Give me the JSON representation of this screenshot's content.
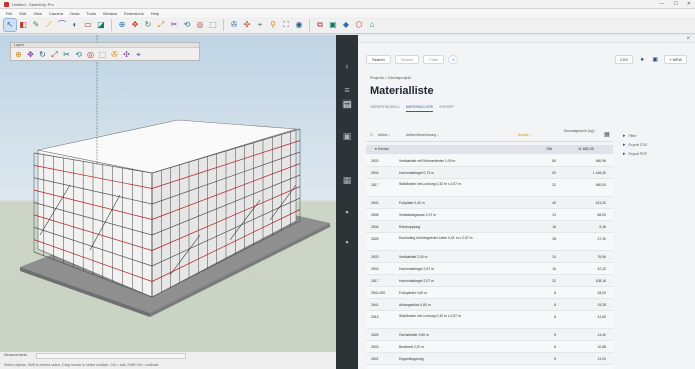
{
  "window": {
    "title": "Untitled - SketchUp Pro",
    "controls": [
      "—",
      "☐",
      "✕"
    ]
  },
  "menubar": {
    "items": [
      "File",
      "Edit",
      "View",
      "Camera",
      "Draw",
      "Tools",
      "Window",
      "Extensions",
      "Help"
    ]
  },
  "toolbar": {
    "groups": [
      [
        "↖",
        "◧",
        "✎",
        "⟋",
        "⌒",
        "◐",
        "▭",
        "◪"
      ],
      [
        "⊕",
        "✥",
        "↻",
        "⤢",
        "✂",
        "⟲",
        "◎",
        "⬚"
      ],
      [
        "✇",
        "✣",
        "⌖",
        "⚲",
        "⛶",
        "◉"
      ],
      [
        "⧉",
        "▣",
        "◆",
        "⬡",
        "⌂"
      ]
    ],
    "inner_title": "Layers"
  },
  "viewport": {
    "status_label": "Measurements",
    "status_message": "Select objects. Shift to extend select. Drag mouse to select multiple. Ctrl = add, Shift+Ctrl = subtract."
  },
  "darkbar": {
    "icons": [
      "chevron-left-icon",
      "list-icon",
      "layers-icon",
      "box-icon",
      "grid-icon",
      "settings-icon"
    ]
  },
  "panel": {
    "search": {
      "label": "Search",
      "placeholder": "Search",
      "filter": "Filter"
    },
    "right_buttons": {
      "export": "CSV",
      "print": "PDF",
      "new_label": "+ NEW"
    },
    "breadcrumb": "Projects  >  Gerüstprojekt",
    "title": "Materialliste",
    "tabs": [
      "GERÜSTMODELL",
      "MATERIALLISTE",
      "EXPORT"
    ],
    "active_tab": 1,
    "table": {
      "headers": [
        "Artikel ↓",
        "Artikel-Bezeichnung ↓",
        "Anzahl ↓",
        "Gesamtgewicht (kg) ↓"
      ],
      "group": {
        "label": "▾ Gerüst",
        "count": "786",
        "weight": "11 682,05"
      },
      "rows": [
        {
          "id": "2603",
          "name": "Vertikalstiel mit Rohrverbinder 2,00 m",
          "qty": "80",
          "weight": "480,96",
          "tall": false
        },
        {
          "id": "2604",
          "name": "Horizontalriegel 0,73 m",
          "qty": "52",
          "weight": "1 166,40",
          "tall": false
        },
        {
          "id": "2617",
          "name": "Stahlboden mit Lochung 0,32 m x 2,57 m",
          "qty": "32",
          "weight": "480,00",
          "tall": true
        },
        {
          "id": "2640",
          "name": "Fußplatte 0,40 m",
          "qty": "40",
          "weight": "241,20",
          "tall": false
        },
        {
          "id": "2606",
          "name": "Vertikaldiagonale 2,07 m",
          "qty": "24",
          "weight": "68,00",
          "tall": false
        },
        {
          "id": "2604",
          "name": "Rohrkupplung",
          "qty": "16",
          "weight": "5,36",
          "tall": false
        },
        {
          "id": "2626",
          "name": "Durchstieg mit integrierter Leiter 0,61 m x 2,57 m",
          "qty": "28",
          "weight": "27,30",
          "tall": true
        },
        {
          "id": "2603",
          "name": "Vertikalstiel 2,00 m",
          "qty": "24",
          "weight": "76,96",
          "tall": false
        },
        {
          "id": "2603",
          "name": "Horizontalriegel 2,57 m",
          "qty": "16",
          "weight": "42,32",
          "tall": false
        },
        {
          "id": "2617",
          "name": "Horizontalriegel 2,07 m",
          "qty": "32",
          "weight": "108,16",
          "tall": false
        },
        {
          "id": "2641.000",
          "name": "Fußspindel 0,60 m",
          "qty": "8",
          "weight": "34,00",
          "tall": false
        },
        {
          "id": "2641",
          "name": "Anfangsstück 0,60 m",
          "qty": "8",
          "weight": "19,28",
          "tall": false
        },
        {
          "id": "2615",
          "name": "Stahlboden mit Lochung 0,32 m x 2,57 m",
          "qty": "8",
          "weight": "41,60",
          "tall": true
        },
        {
          "id": "2626",
          "name": "Gerüsthalter 0,60 m",
          "qty": "8",
          "weight": "14,40",
          "tall": false
        },
        {
          "id": "2603",
          "name": "Bordbrett 2,57 m",
          "qty": "8",
          "weight": "10,88",
          "tall": false
        },
        {
          "id": "2601",
          "name": "Doppelkupplung",
          "qty": "8",
          "weight": "13,20",
          "tall": false
        },
        {
          "id": "2606",
          "name": "Vertikaldiagonale 2,57 m",
          "qty": "8",
          "weight": "80,00",
          "tall": false
        }
      ]
    },
    "side_links": [
      "Filter",
      "Export CSV",
      "Export PDF"
    ]
  }
}
